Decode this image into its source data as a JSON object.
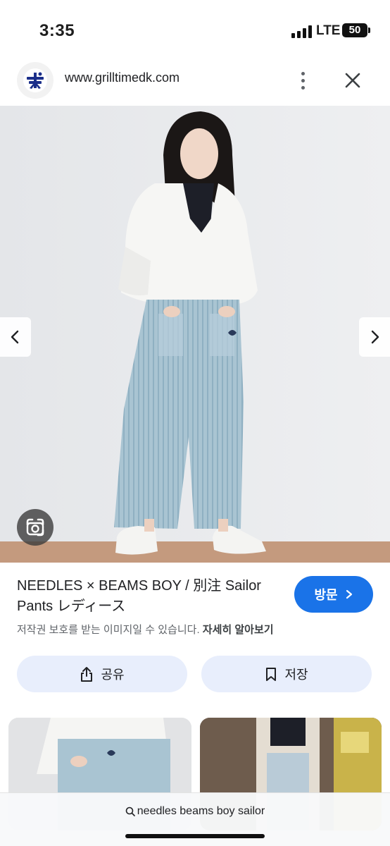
{
  "status_bar": {
    "time": "3:35",
    "network": "LTE",
    "battery": "50"
  },
  "browser": {
    "url": "www.grilltimedk.com"
  },
  "result": {
    "title": "NEEDLES × BEAMS BOY / 別注 Sailor Pants レディース",
    "visit_label": "방문",
    "copyright_text": "저작권 보호를 받는 이미지일 수 있습니다.",
    "learn_more": "자세히 알아보기"
  },
  "actions": {
    "share_label": "공유",
    "save_label": "저장"
  },
  "search": {
    "query": "needles beams boy sailor"
  },
  "colors": {
    "accent": "#1a73e8",
    "action_bg": "#e8eefc"
  },
  "icons": [
    "site-logo-icon",
    "more-vert-icon",
    "close-icon",
    "chevron-left-icon",
    "chevron-right-icon",
    "google-lens-icon",
    "share-icon",
    "bookmark-icon",
    "search-icon"
  ]
}
